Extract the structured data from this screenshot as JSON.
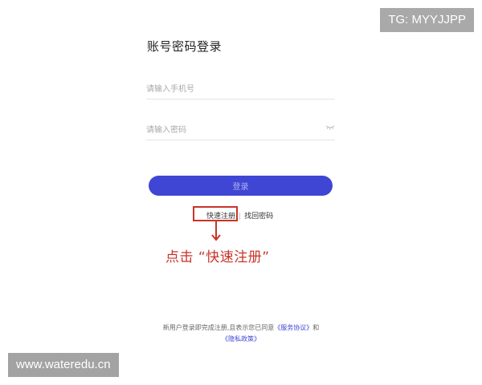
{
  "watermarks": {
    "top_right": "TG: MYYJJPP",
    "bottom_left": "www.wateredu.cn"
  },
  "login": {
    "title": "账号密码登录",
    "phone_placeholder": "请输入手机号",
    "password_placeholder": "请输入密码",
    "password_toggle_icon": "eye-closed-icon",
    "submit_label": "登录",
    "submit_color": "#3f46d3"
  },
  "links": {
    "register": "快速注册",
    "separator": "|",
    "forgot_password": "找回密码"
  },
  "annotation": {
    "text": "点击 “快速注册”",
    "color": "#c8342a"
  },
  "agreement": {
    "prefix": "新用户登录即完成注册,且表示您已同意",
    "service_terms": "《服务协议》",
    "conjunction": "和",
    "privacy_policy": "《隐私政策》"
  }
}
